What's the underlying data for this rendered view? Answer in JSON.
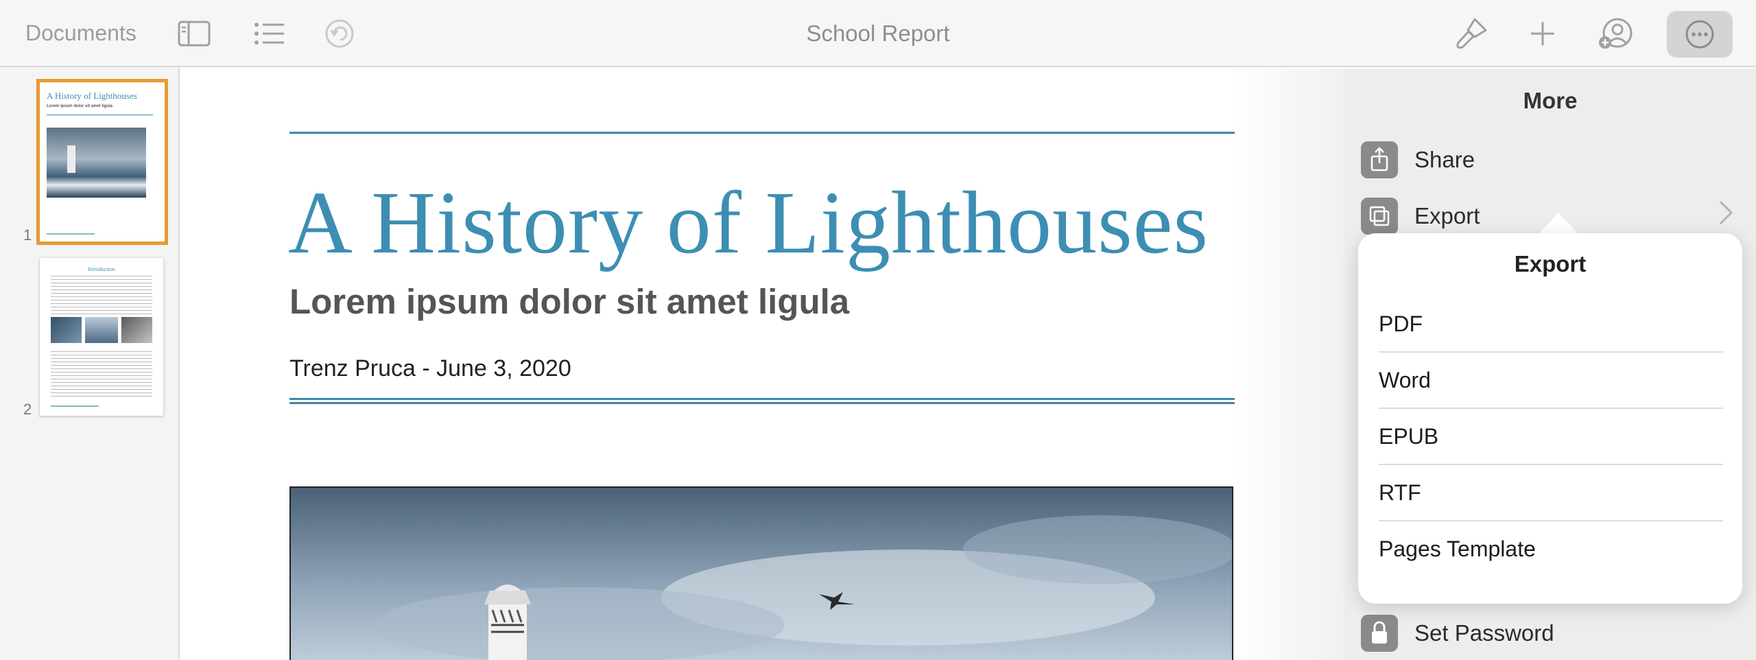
{
  "toolbar": {
    "documents_label": "Documents",
    "title": "School Report",
    "icons": [
      "sidebar-icon",
      "outline-list-icon",
      "undo-icon",
      "paintbrush-icon",
      "plus-icon",
      "collaborate-icon",
      "more-icon"
    ]
  },
  "sidebar": {
    "pages": [
      {
        "number": "1",
        "selected": true,
        "mini_title": "A History of Lighthouses",
        "mini_subtitle": "Lorem ipsum dolor sit amet ligula"
      },
      {
        "number": "2",
        "selected": false,
        "mini_heading": "Introduction"
      }
    ]
  },
  "document": {
    "title": "A History of Lighthouses",
    "subtitle": "Lorem ipsum dolor sit amet ligula",
    "author_line": "Trenz Pruca - June 3, 2020",
    "accent_color": "#3d8eb3"
  },
  "more_panel": {
    "title": "More",
    "items": [
      {
        "label": "Share",
        "icon": "share-icon"
      },
      {
        "label": "Export",
        "icon": "export-icon"
      },
      {
        "label": "Set Password",
        "icon": "lock-icon"
      }
    ]
  },
  "export_popover": {
    "title": "Export",
    "options": [
      "PDF",
      "Word",
      "EPUB",
      "RTF",
      "Pages Template"
    ]
  },
  "colors": {
    "selection_outline": "#e59b32",
    "toolbar_bg": "#f6f6f6",
    "panel_bg": "#ededed"
  }
}
